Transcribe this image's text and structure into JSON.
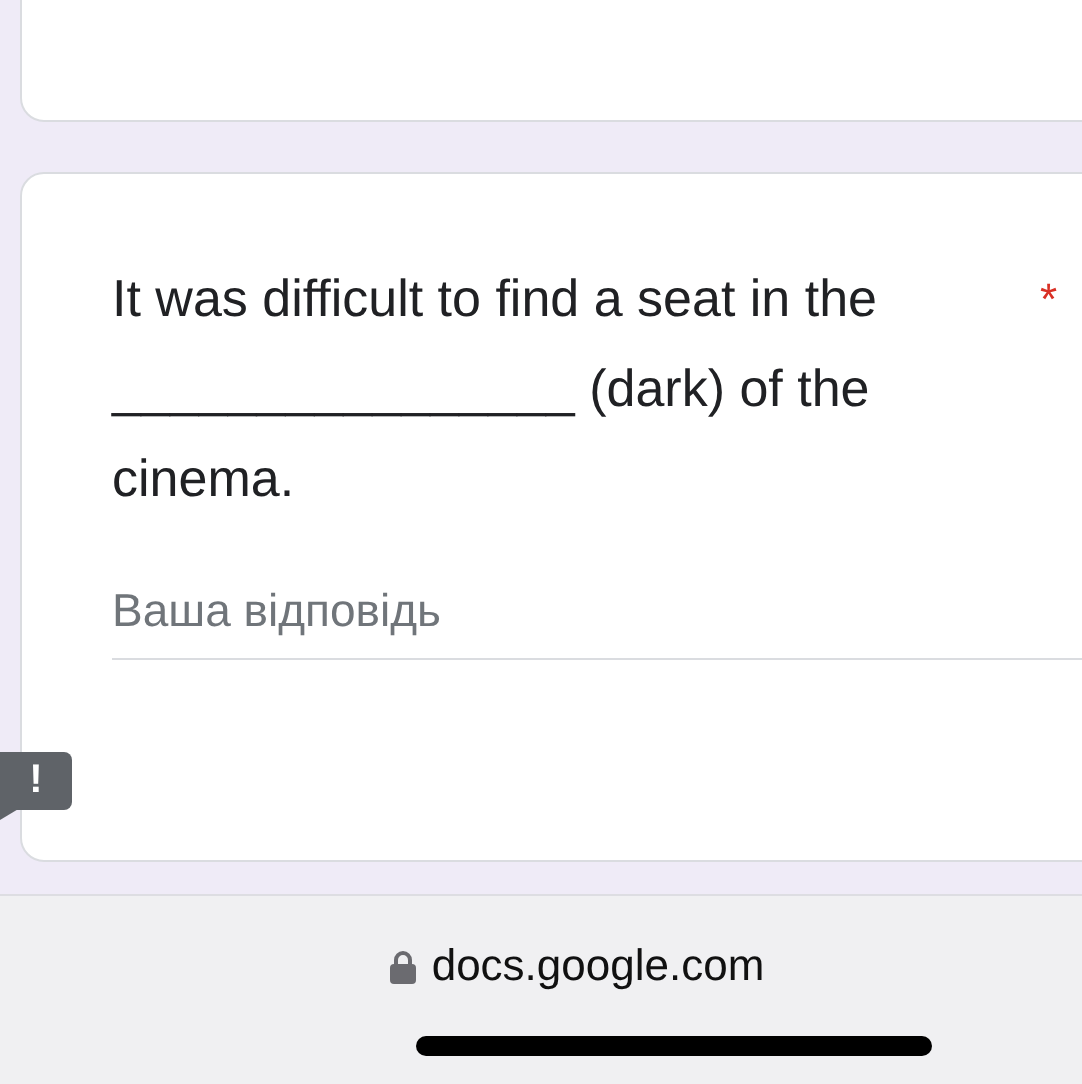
{
  "question": {
    "text": "It was difficult to find a seat in the ________________ (dark) of the cinema.",
    "required_mark": "*"
  },
  "answer": {
    "placeholder": "Ваша відповідь"
  },
  "feedback_badge": {
    "label": "!"
  },
  "address_bar": {
    "url": "docs.google.com"
  }
}
